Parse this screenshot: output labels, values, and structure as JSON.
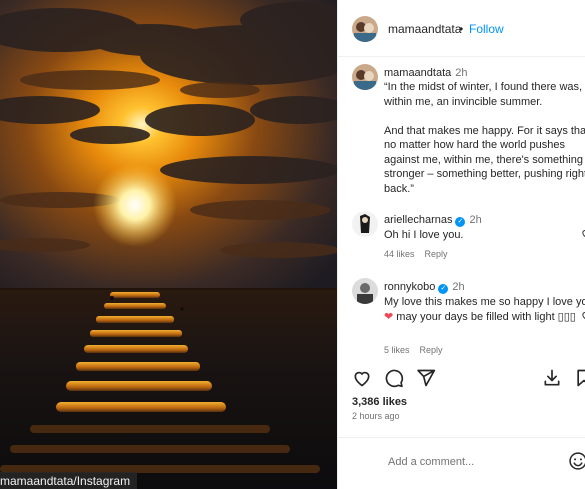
{
  "photo": {
    "credit": "mamaandtata/Instagram"
  },
  "header": {
    "username": "mamaandtata",
    "separator": "•",
    "follow_label": "Follow"
  },
  "caption": {
    "username": "mamaandtata",
    "time": "2h",
    "text": "“In the midst of winter, I found there was, within me, an invincible summer.\n\nAnd that makes me happy. For it says that no matter how hard the world pushes against me, within me, there's something stronger – something better, pushing right back.”"
  },
  "comments": [
    {
      "username": "ariellecharnas",
      "verified": true,
      "time": "2h",
      "text": "Oh hi I love you.",
      "likes": "44 likes",
      "reply_label": "Reply"
    },
    {
      "username": "ronnykobo",
      "verified": true,
      "time": "2h",
      "text_before": "My love this makes me so happy I love you ",
      "heart": "❤",
      "text_after": " may your days be filled with light ▯▯▯",
      "likes": "5 likes",
      "reply_label": "Reply"
    }
  ],
  "actions": {
    "icons": [
      "heart-icon",
      "comment-icon",
      "share-icon",
      "download-icon",
      "bookmark-icon"
    ]
  },
  "post": {
    "likes": "3,386 likes",
    "posted": "2 hours ago"
  },
  "add_comment": {
    "placeholder": "Add a comment..."
  },
  "colors": {
    "link_blue": "#0095f6",
    "heart_red": "#ed4956",
    "muted": "#737373"
  }
}
